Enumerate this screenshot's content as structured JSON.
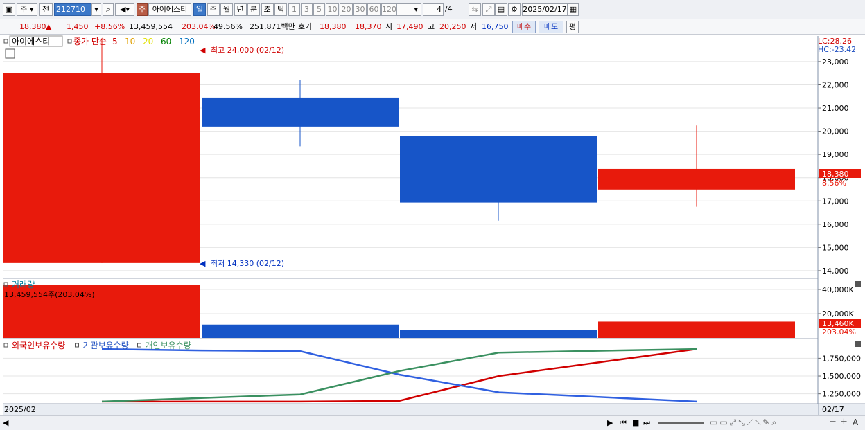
{
  "toolbar": {
    "mode1": "주",
    "mode2": "전",
    "code": "212710",
    "name_tag": "주",
    "stock_name": "아이에스티",
    "periods": [
      "일",
      "주",
      "월",
      "년",
      "분",
      "초",
      "틱"
    ],
    "intervals": [
      "1",
      "3",
      "5",
      "10",
      "20",
      "30",
      "60",
      "120"
    ],
    "page": "4",
    "page_total": "/4",
    "date": "2025/02/17"
  },
  "quote": {
    "price": "18,380",
    "arrow": "▲",
    "change": "1,450",
    "change_pct": "+8.56%",
    "volume": "13,459,554",
    "vol_ratio": "203.04%",
    "turnover": "49.56%",
    "amount": "251,871백만",
    "hoga_label": "호가",
    "bid": "18,380",
    "ask": "18,370",
    "open_label": "시",
    "open": "17,490",
    "high_label": "고",
    "high": "20,250",
    "low_label": "저",
    "low": "16,750",
    "buy_label": "매수",
    "sell_label": "매도",
    "eval_label": "평"
  },
  "price_panel": {
    "legend_name": "아이에스티",
    "legend_ma": "종가 단순",
    "ma_periods": [
      "5",
      "10",
      "20",
      "60",
      "120"
    ],
    "ma_colors": [
      "#d00000",
      "#e0a000",
      "#e0e000",
      "#008000",
      "#0070c0"
    ],
    "lc": "LC:28.26",
    "hc": "HC:-23.42",
    "max_label": "최고 24,000 (02/12)",
    "min_label": "최저 14,330 (02/12)",
    "last_price": "18,380",
    "last_pct": "8.56%"
  },
  "volume_panel": {
    "title": "거래량",
    "value_label": "13,459,554주(203.04%)",
    "last_label": "13,460K",
    "last_pct": "203.04%"
  },
  "holding_panel": {
    "legend": [
      "외국인보유수량",
      "기관보유수량",
      "개인보유수량"
    ]
  },
  "footer": {
    "date_left": "2025/02",
    "date_right": "02/17"
  },
  "chart_data": [
    {
      "type": "candlestick",
      "title": "아이에스티",
      "x": [
        "c1",
        "c2",
        "c3",
        "c4"
      ],
      "open": [
        14330,
        20200,
        19800,
        17490
      ],
      "close": [
        22500,
        21450,
        16930,
        18380
      ],
      "high": [
        24000,
        22200,
        19800,
        20250
      ],
      "low": [
        14330,
        19350,
        16150,
        16750
      ],
      "colors": [
        "#e81a0c",
        "#1755c8",
        "#1755c8",
        "#e81a0c"
      ],
      "yticks": [
        14000,
        15000,
        16000,
        17000,
        18000,
        19000,
        20000,
        21000,
        22000,
        23000
      ],
      "ylim": [
        13700,
        24100
      ]
    },
    {
      "type": "bar",
      "title": "거래량",
      "x": [
        "c1",
        "c2",
        "c3",
        "c4"
      ],
      "values": [
        44000,
        11000,
        6500,
        13460
      ],
      "colors": [
        "#e81a0c",
        "#1755c8",
        "#1755c8",
        "#e81a0c"
      ],
      "yticks": [
        20000,
        40000
      ],
      "ytick_labels": [
        "20,000K",
        "40,000K"
      ],
      "ylim": [
        0,
        48000
      ]
    },
    {
      "type": "line",
      "x": [
        "c1",
        "c2",
        "c3",
        "c4",
        "c5",
        "c6"
      ],
      "series": [
        {
          "name": "외국인보유수량",
          "color": "#d00000",
          "values": [
            1140000,
            1140000,
            1140000,
            1150000,
            1500000,
            1880000
          ]
        },
        {
          "name": "기관보유수량",
          "color": "#3060e0",
          "values": [
            1880000,
            1860000,
            1850000,
            1520000,
            1270000,
            1140000
          ]
        },
        {
          "name": "개인보유수량",
          "color": "#3a9060",
          "values": [
            1140000,
            1190000,
            1240000,
            1570000,
            1830000,
            1880000
          ]
        }
      ],
      "yticks": [
        1250000,
        1500000,
        1750000
      ],
      "ytick_labels": [
        "1,250,000",
        "1,500,000",
        "1,750,000"
      ],
      "ylim": [
        1120000,
        1900000
      ]
    }
  ]
}
